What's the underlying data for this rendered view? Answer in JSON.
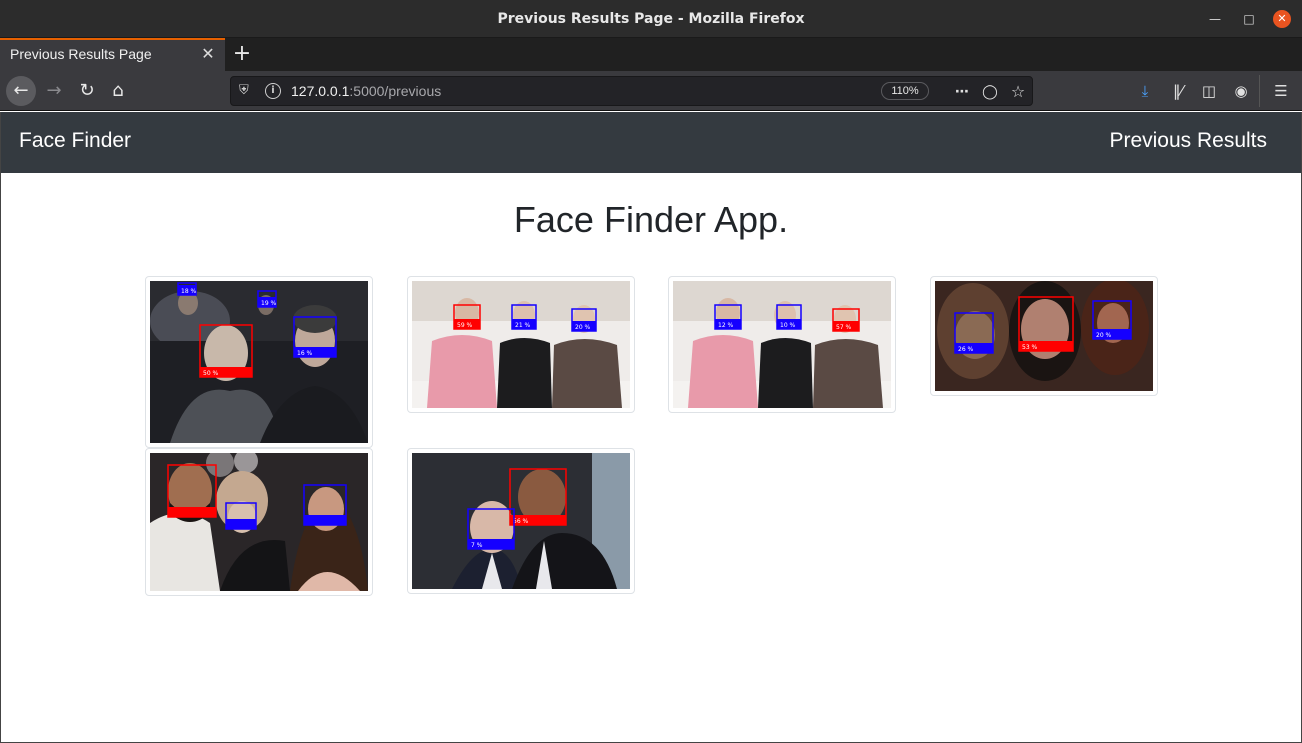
{
  "window": {
    "title": "Previous Results Page - Mozilla Firefox"
  },
  "tabs": [
    {
      "label": "Previous Results Page"
    }
  ],
  "addressbar": {
    "host": "127.0.0.1",
    "path": ":5000/previous",
    "zoom": "110%"
  },
  "site": {
    "brand": "Face Finder",
    "nav_link": "Previous Results",
    "heading": "Face Finder App."
  },
  "results": [
    {
      "scene": "two-men-dark",
      "boxes": [
        {
          "color": "#1500ff",
          "label": "18 %"
        },
        {
          "color": "#1500ff",
          "label": "19 %"
        },
        {
          "color": "#ff0000",
          "label": "50 %"
        },
        {
          "color": "#1500ff",
          "label": "16 %"
        }
      ]
    },
    {
      "scene": "three-women-couch",
      "boxes": [
        {
          "color": "#ff0000",
          "label": "59 %"
        },
        {
          "color": "#1500ff",
          "label": "21 %"
        },
        {
          "color": "#1500ff",
          "label": "20 %"
        }
      ]
    },
    {
      "scene": "three-women-couch",
      "boxes": [
        {
          "color": "#1500ff",
          "label": "12 %"
        },
        {
          "color": "#1500ff",
          "label": "10 %"
        },
        {
          "color": "#ff0000",
          "label": "57 %"
        }
      ]
    },
    {
      "scene": "three-faces-dark",
      "boxes": [
        {
          "color": "#1500ff",
          "label": "26 %"
        },
        {
          "color": "#ff0000",
          "label": "53 %"
        },
        {
          "color": "#1500ff",
          "label": "20 %"
        }
      ]
    },
    {
      "scene": "family-balloons",
      "boxes": [
        {
          "color": "#ff0000",
          "label": ""
        },
        {
          "color": "#1500ff",
          "label": ""
        },
        {
          "color": "#1500ff",
          "label": ""
        }
      ]
    },
    {
      "scene": "two-men-suits",
      "boxes": [
        {
          "color": "#ff0000",
          "label": "56 %"
        },
        {
          "color": "#1500ff",
          "label": "7 %"
        }
      ]
    }
  ]
}
